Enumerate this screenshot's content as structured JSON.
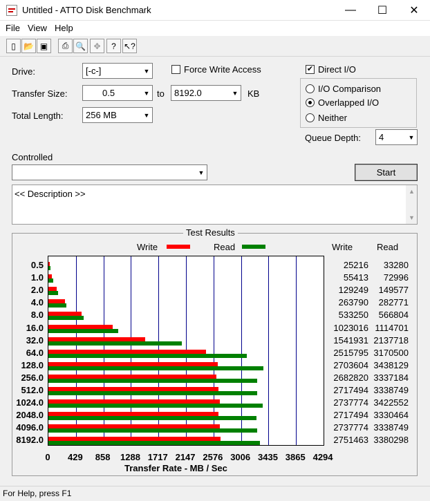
{
  "window": {
    "title": "Untitled - ATTO Disk Benchmark",
    "minimize": "—",
    "maximize": "☐",
    "close": "✕"
  },
  "menu": [
    {
      "label": "File"
    },
    {
      "label": "View"
    },
    {
      "label": "Help"
    }
  ],
  "toolbar": [
    "new-icon",
    "open-icon",
    "save-icon",
    "print-icon",
    "print-preview-icon",
    "move-icon",
    "help-icon",
    "context-help-icon"
  ],
  "form": {
    "drive_label": "Drive:",
    "drive_value": "[-c-]",
    "force_write_label": "Force Write Access",
    "force_write_checked": false,
    "direct_io_label": "Direct I/O",
    "direct_io_checked": true,
    "transfer_size_label": "Transfer Size:",
    "transfer_from": "0.5",
    "to_label": "to",
    "transfer_to": "8192.0",
    "kb_label": "KB",
    "total_length_label": "Total Length:",
    "total_length_value": "256 MB",
    "io_options": [
      {
        "label": "I/O Comparison",
        "selected": false
      },
      {
        "label": "Overlapped I/O",
        "selected": true
      },
      {
        "label": "Neither",
        "selected": false
      }
    ],
    "queue_depth_label": "Queue Depth:",
    "queue_depth_value": "4",
    "controlled_label": "Controlled",
    "controlled_value": "",
    "start_label": "Start",
    "description": "<< Description >>"
  },
  "results": {
    "title": "Test Results",
    "legend_write": "Write",
    "legend_read": "Read",
    "col_write": "Write",
    "col_read": "Read",
    "xlabel": "Transfer Rate - MB / Sec",
    "colors": {
      "write": "#ff0000",
      "read": "#008000",
      "grid": "#00008b"
    }
  },
  "chart_data": {
    "type": "bar",
    "orientation": "horizontal",
    "title": "Test Results",
    "xlabel": "Transfer Rate - MB / Sec",
    "xlim": [
      0,
      4294
    ],
    "x_ticks": [
      "0",
      "429",
      "858",
      "1288",
      "1717",
      "2147",
      "2576",
      "3006",
      "3435",
      "3865",
      "4294"
    ],
    "categories": [
      "0.5",
      "1.0",
      "2.0",
      "4.0",
      "8.0",
      "16.0",
      "32.0",
      "64.0",
      "128.0",
      "256.0",
      "512.0",
      "1024.0",
      "2048.0",
      "4096.0",
      "8192.0"
    ],
    "series": [
      {
        "name": "Write",
        "values": [
          25216,
          55413,
          129249,
          263790,
          533250,
          1023016,
          1541931,
          2515795,
          2703604,
          2682820,
          2717494,
          2737774,
          2717494,
          2737774,
          2751463
        ]
      },
      {
        "name": "Read",
        "values": [
          33280,
          72996,
          149577,
          282771,
          566804,
          1114701,
          2137718,
          3170500,
          3438129,
          3337184,
          3338749,
          3422552,
          3330464,
          3338749,
          3380298
        ]
      }
    ]
  },
  "status": "For Help, press F1"
}
